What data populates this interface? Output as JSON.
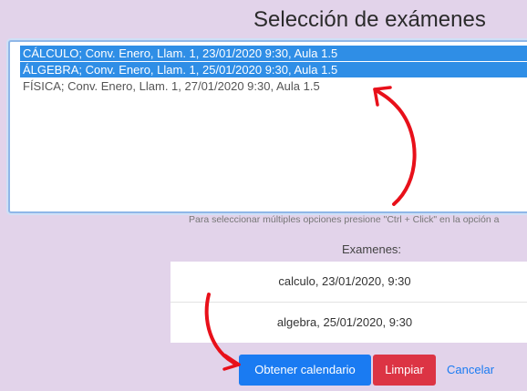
{
  "page": {
    "title": "Selección de exámenes"
  },
  "listbox": {
    "options": [
      {
        "label": "CÁLCULO; Conv. Enero, Llam. 1, 23/01/2020 9:30, Aula 1.5",
        "selected": true
      },
      {
        "label": "ÁLGEBRA; Conv. Enero, Llam. 1, 25/01/2020 9:30, Aula 1.5",
        "selected": true
      },
      {
        "label": "FÍSICA; Conv. Enero, Llam. 1, 27/01/2020 9:30, Aula 1.5",
        "selected": false
      }
    ],
    "hint": "Para seleccionar múltiples opciones presione \"Ctrl + Click\" en la opción a"
  },
  "selected_exams": {
    "heading": "Examenes:",
    "items": [
      "calculo, 23/01/2020, 9:30",
      "algebra, 25/01/2020, 9:30"
    ]
  },
  "actions": {
    "get_calendar": "Obtener calendario",
    "clear": "Limpiar",
    "cancel": "Cancelar"
  },
  "colors": {
    "background": "#e2d3ea",
    "selection": "#2f8ee6",
    "primary": "#1a7bf2",
    "danger": "#dc3444",
    "annotation_arrow": "#e8101a"
  },
  "annotations": [
    "arrow-to-selected-options",
    "arrow-to-get-calendar-button"
  ]
}
